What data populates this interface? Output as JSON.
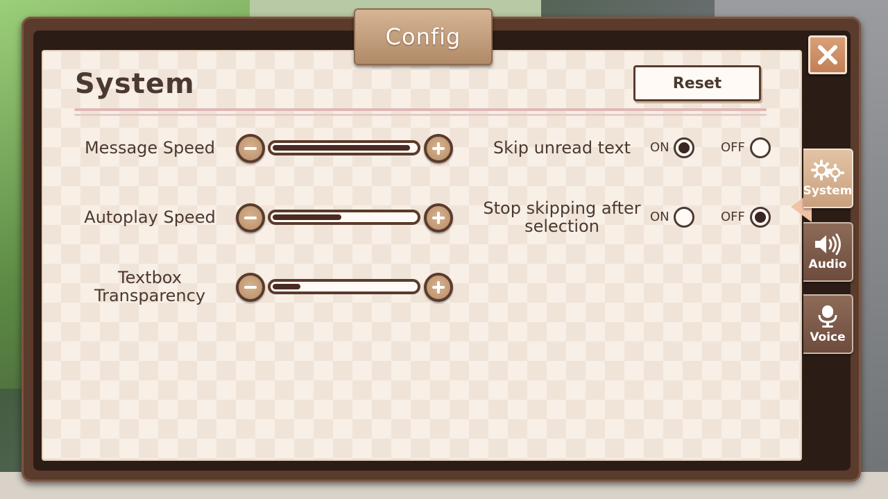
{
  "dialog": {
    "title": "Config"
  },
  "section": {
    "title": "System",
    "reset_label": "Reset"
  },
  "sliders": [
    {
      "label": "Message Speed",
      "value": 1.0
    },
    {
      "label": "Autoplay Speed",
      "value": 0.5
    },
    {
      "label": "Textbox Transparency",
      "value": 0.2
    }
  ],
  "toggles": [
    {
      "label": "Skip unread text",
      "on_label": "ON",
      "off_label": "OFF",
      "selected": "ON"
    },
    {
      "label": "Stop skipping after selection",
      "on_label": "ON",
      "off_label": "OFF",
      "selected": "OFF"
    }
  ],
  "side_tabs": [
    {
      "label": "System",
      "icon": "gears-icon",
      "active": true
    },
    {
      "label": "Audio",
      "icon": "speaker-icon",
      "active": false
    },
    {
      "label": "Voice",
      "icon": "microphone-icon",
      "active": false
    }
  ],
  "colors": {
    "frame": "#5a3b2c",
    "panel": "#f8efe6",
    "accent": "#c9a07d",
    "text": "#4b3931"
  }
}
